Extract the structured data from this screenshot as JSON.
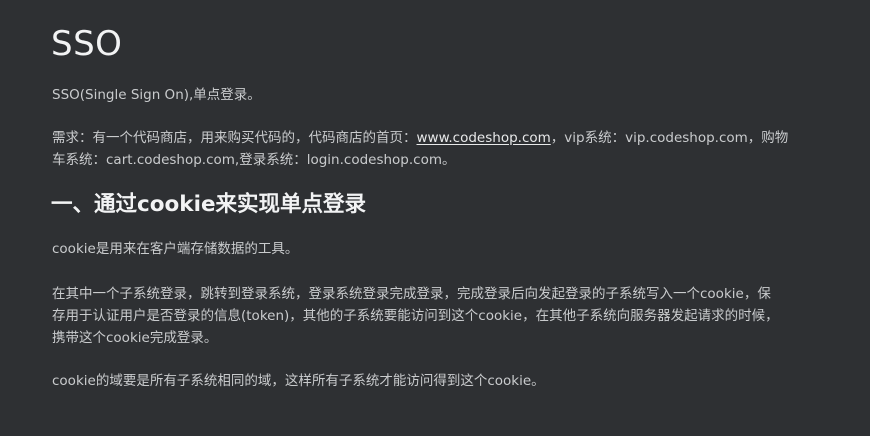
{
  "document": {
    "title": "SSO",
    "intro": "SSO(Single Sign On),单点登录。",
    "requirement": {
      "prefix": "需求：有一个代码商店，用来购买代码的，代码商店的首页：",
      "link": "www.codeshop.com",
      "line1_suffix": "，vip系统：vip.codeshop.com，购物",
      "line2": "车系统：cart.codeshop.com,登录系统：login.codeshop.com。"
    },
    "section_heading": "一、通过cookie来实现单点登录",
    "cookie_desc": "cookie是用来在客户端存储数据的工具。",
    "flow": {
      "line1": "在其中一个子系统登录，跳转到登录系统，登录系统登录完成登录，完成登录后向发起登录的子系统写入一个cookie，保",
      "line2": "存用于认证用户是否登录的信息(token)，其他的子系统要能访问到这个cookie，在其他子系统向服务器发起请求的时候，",
      "line3": "携带这个cookie完成登录。"
    },
    "domain_note": "cookie的域要是所有子系统相同的域，这样所有子系统才能访问得到这个cookie。"
  }
}
